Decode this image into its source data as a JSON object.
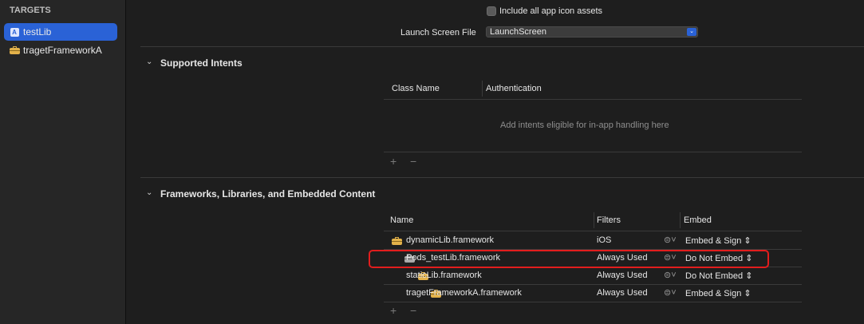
{
  "sidebar": {
    "header": "TARGETS",
    "items": [
      {
        "label": "testLib",
        "icon": "app-icon",
        "selected": true
      },
      {
        "label": "tragetFrameworkA",
        "icon": "toolbox-icon",
        "selected": false
      }
    ]
  },
  "app_icons": {
    "include_all_label": "Include all app icon assets",
    "include_all_checked": false,
    "launch_label": "Launch Screen File",
    "launch_value": "LaunchScreen"
  },
  "intents": {
    "title": "Supported Intents",
    "col_class": "Class Name",
    "col_auth": "Authentication",
    "empty_text": "Add intents eligible for in-app handling here",
    "add": "+",
    "remove": "−"
  },
  "frameworks": {
    "title": "Frameworks, Libraries, and Embedded Content",
    "col_name": "Name",
    "col_filters": "Filters",
    "col_embed": "Embed",
    "rows": [
      {
        "name": "dynamicLib.framework",
        "filter": "iOS",
        "embed": "Embed & Sign",
        "icon": "toolbox-icon"
      },
      {
        "name": "Pods_testLib.framework",
        "filter": "Always Used",
        "embed": "Do Not Embed",
        "icon": "toolbox-icon"
      },
      {
        "name": "staticLib.framework",
        "filter": "Always Used",
        "embed": "Do Not Embed",
        "icon": "toolbox-icon"
      },
      {
        "name": "tragetFrameworkA.framework",
        "filter": "Always Used",
        "embed": "Embed & Sign",
        "icon": "toolbox-icon"
      }
    ],
    "add": "+",
    "remove": "−"
  },
  "colors": {
    "accent": "#2a62d6",
    "highlight_border": "#e21d1d",
    "toolbox": "#e3b24a"
  }
}
